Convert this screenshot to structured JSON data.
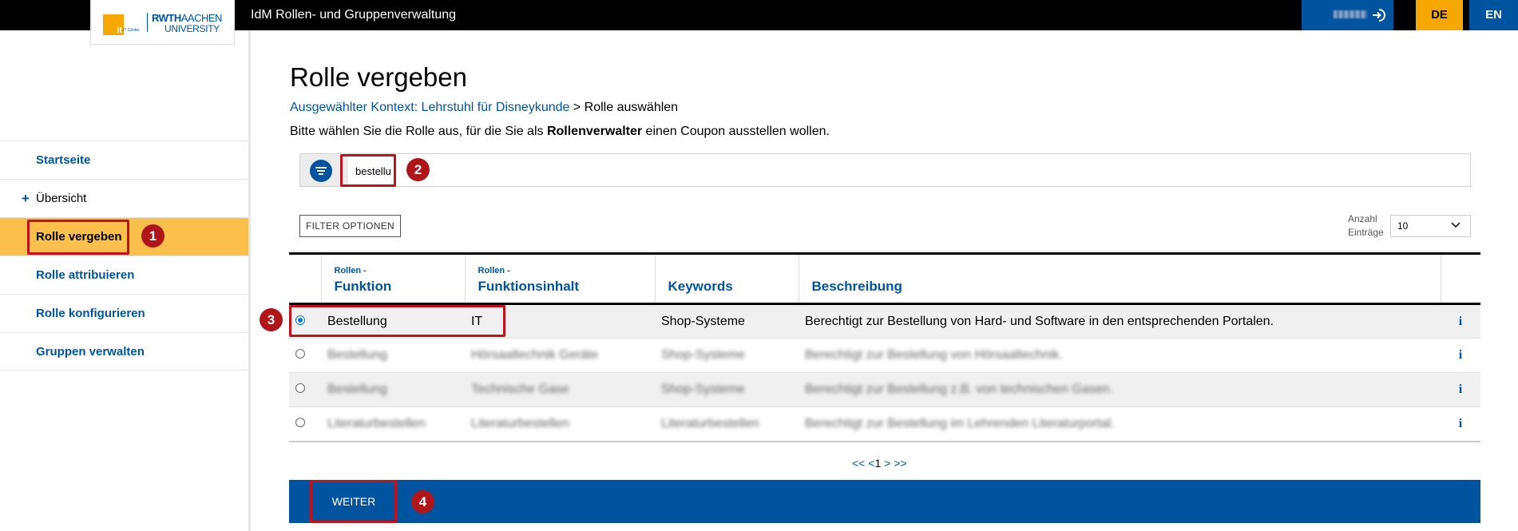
{
  "header": {
    "app_title": "IdM Rollen- und Gruppenverwaltung",
    "logo_it": "it",
    "logo_it_sub": "IT Center",
    "logo_rwth": "RWTH",
    "logo_aachen": "AACHEN",
    "logo_university": "UNIVERSITY",
    "lang_de": "DE",
    "lang_en": "EN"
  },
  "sidebar": {
    "items": [
      {
        "label": "Startseite"
      },
      {
        "label": "Übersicht",
        "prefix": "+"
      },
      {
        "label": "Rolle vergeben"
      },
      {
        "label": "Rolle attribuieren"
      },
      {
        "label": "Rolle konfigurieren"
      },
      {
        "label": "Gruppen verwalten"
      }
    ]
  },
  "main": {
    "title": "Rolle vergeben",
    "breadcrumb_link": "Ausgewählter Kontext: Lehrstuhl für Disneykunde",
    "breadcrumb_sep": " > ",
    "breadcrumb_current": "Rolle auswählen",
    "intro_pre": "Bitte wählen Sie die Rolle aus, für die Sie als ",
    "intro_bold": "Rollenverwalter",
    "intro_post": " einen Coupon ausstellen wollen.",
    "search_value": "bestellu",
    "filter_options_label": "FILTER OPTIONEN",
    "anzahl_label_1": "Anzahl",
    "anzahl_label_2": "Einträge",
    "anzahl_value": "10"
  },
  "table": {
    "headers": {
      "funktion_small": "Rollen -",
      "funktion_big": "Funktion",
      "inhalt_small": "Rollen -",
      "inhalt_big": "Funktionsinhalt",
      "keywords": "Keywords",
      "beschreibung": "Beschreibung"
    },
    "rows": [
      {
        "funktion": "Bestellung",
        "inhalt": "IT",
        "keywords": "Shop-Systeme",
        "beschreibung": "Berechtigt zur Bestellung von Hard- und Software in den entsprechenden Portalen.",
        "info": "i"
      },
      {
        "funktion": "Bestellung",
        "inhalt": "Hörsaaltechnik Geräte",
        "keywords": "Shop-Systeme",
        "beschreibung": "Berechtigt zur Bestellung von Hörsaaltechnik.",
        "info": "i"
      },
      {
        "funktion": "Bestellung",
        "inhalt": "Technische Gase",
        "keywords": "Shop-Systeme",
        "beschreibung": "Berechtigt zur Bestellung z.B. von technischen Gasen.",
        "info": "i"
      },
      {
        "funktion": "Literaturbestellen",
        "inhalt": "Literaturbestellen",
        "keywords": "Literaturbestellen",
        "beschreibung": "Berechtigt zur Bestellung im Lehrenden Literaturportal.",
        "info": "i"
      }
    ]
  },
  "pager": {
    "first": "<<",
    "prev": "<",
    "current": "1",
    "next": ">",
    "last": ">>"
  },
  "footer": {
    "weiter_label": "WEITER"
  },
  "callouts": {
    "one": "1",
    "two": "2",
    "three": "3",
    "four": "4"
  },
  "colors": {
    "brand_blue": "#00549f",
    "accent_yellow": "#f6a800",
    "active_nav": "#fbbf4c",
    "callout_red": "#c0121a"
  }
}
